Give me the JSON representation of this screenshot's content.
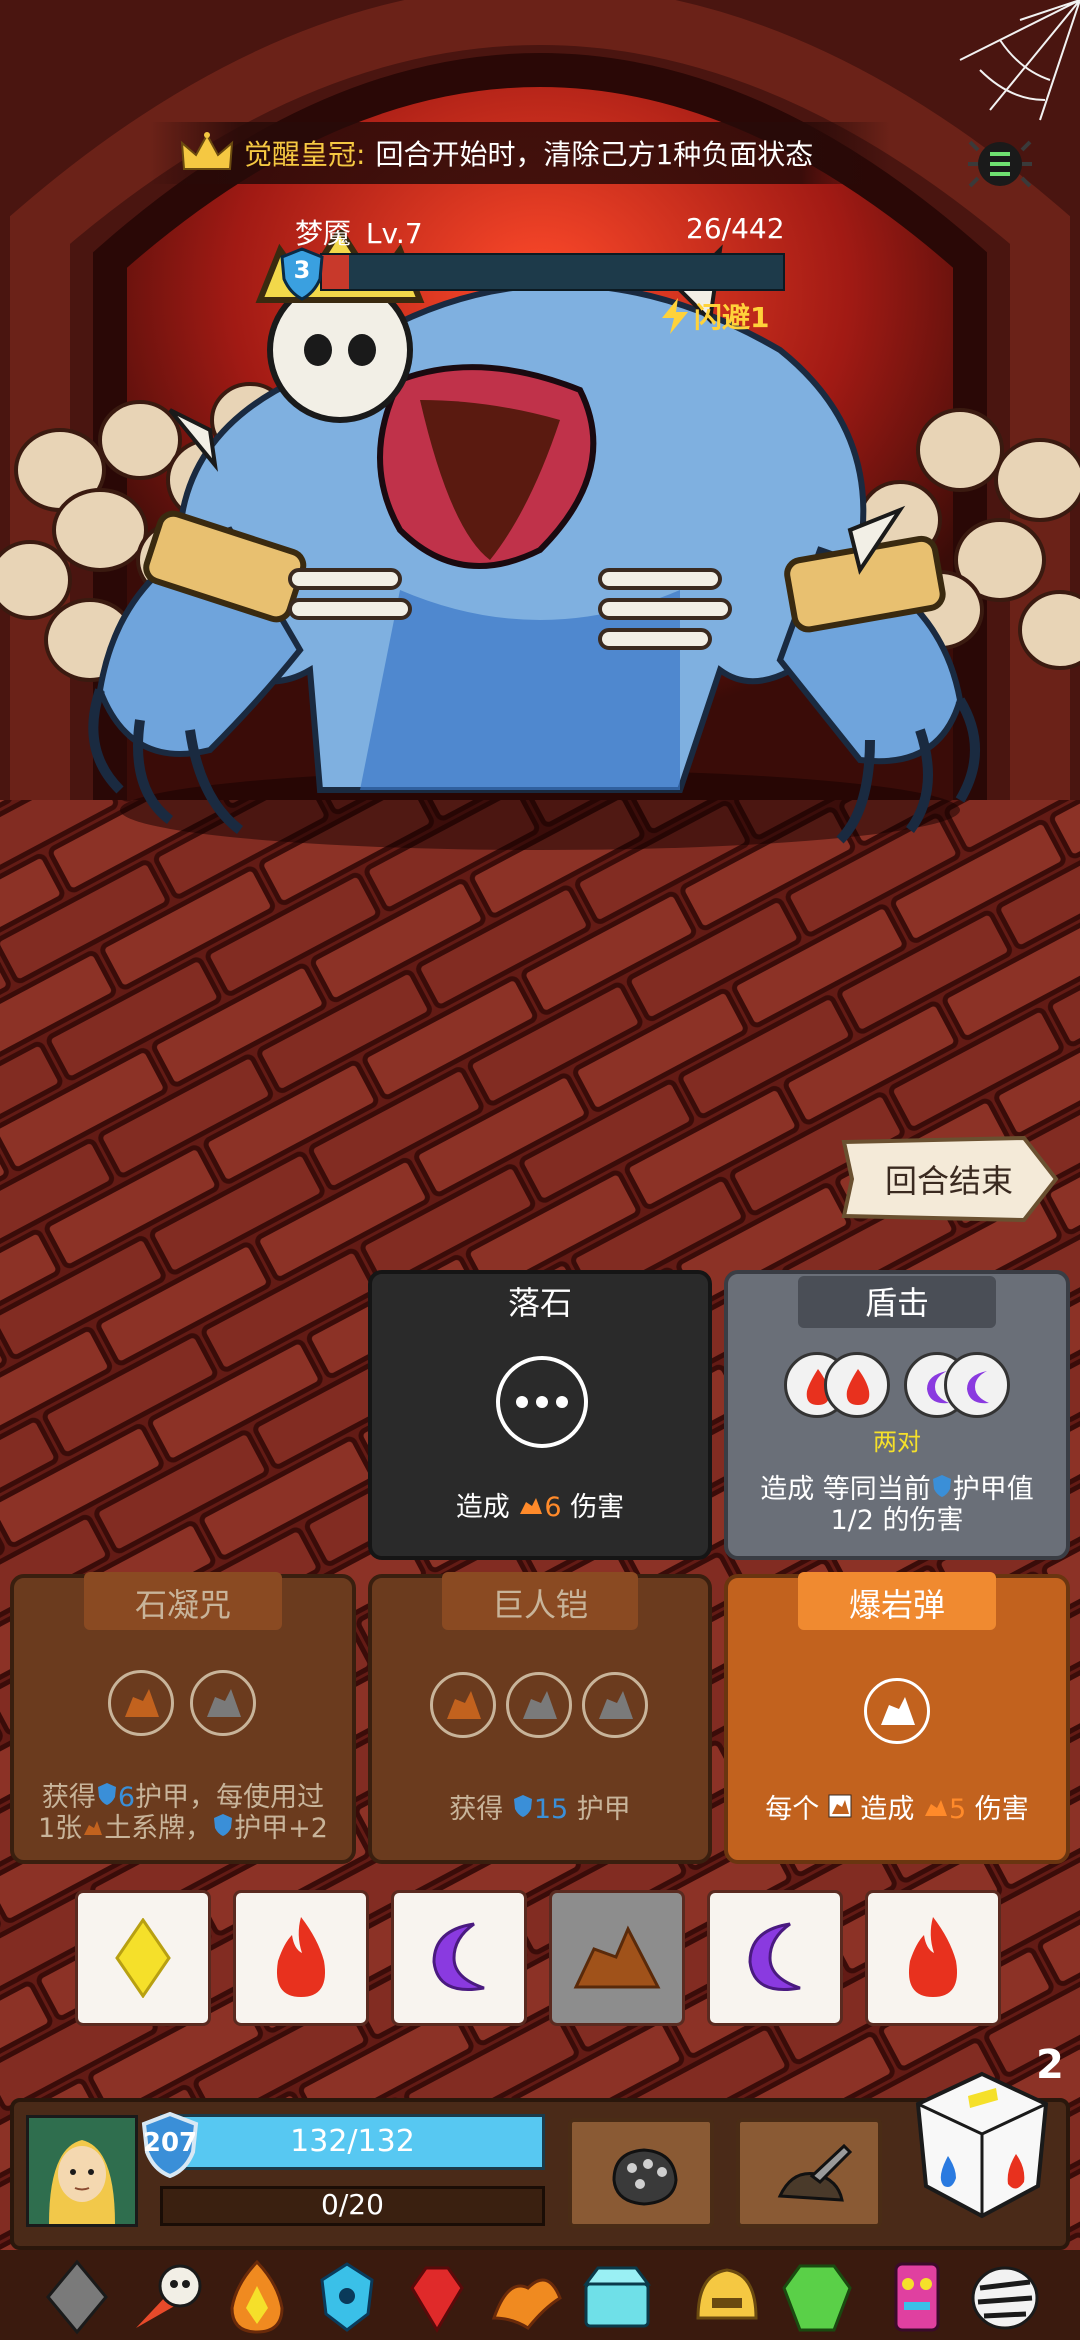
{
  "buff": {
    "name": "觉醒皇冠:",
    "description": "回合开始时，清除己方1种负面状态",
    "icon": "crown-icon"
  },
  "enemy": {
    "name": "梦魇",
    "level": "Lv.7",
    "hp_text": "26/442",
    "hp_fraction": 0.0588,
    "shield": "3",
    "status": "闪避1"
  },
  "end_turn_label": "回合结束",
  "cards": [
    {
      "title": "落石",
      "desc_parts": [
        "造成",
        "6",
        "伤害"
      ],
      "sockets": [
        "any"
      ]
    },
    {
      "title": "盾击",
      "socket_caption": "两对",
      "desc_line1": "造成 等同当前",
      "desc_line1b": "护甲值",
      "desc_line2": "1/2 的伤害",
      "sockets": [
        "fire",
        "fire",
        "moon",
        "moon"
      ]
    },
    {
      "title": "石凝咒",
      "desc_line1a": "获得",
      "desc_line1b": "6",
      "desc_line1c": "护甲，每使用过",
      "desc_line2a": "1张",
      "desc_line2b": "土系牌，",
      "desc_line2c": "护甲+2",
      "sockets": [
        "earth",
        "stone"
      ]
    },
    {
      "title": "巨人铠",
      "desc_a": "获得",
      "desc_b": "15",
      "desc_c": "护甲",
      "sockets": [
        "earth",
        "stone",
        "stone"
      ]
    },
    {
      "title": "爆岩弹",
      "desc_a": "每个",
      "desc_b": "造成",
      "desc_c": "5",
      "desc_d": "伤害",
      "sockets": [
        "earth"
      ]
    }
  ],
  "dice": [
    {
      "face": "diamond",
      "used": false
    },
    {
      "face": "fire",
      "used": false
    },
    {
      "face": "moon",
      "used": false
    },
    {
      "face": "earth",
      "used": true
    },
    {
      "face": "moon",
      "used": false
    },
    {
      "face": "fire",
      "used": false
    }
  ],
  "player": {
    "armor": "207",
    "hp_text": "132/132",
    "hp_fraction": 1.0,
    "energy_text": "0/20",
    "energy_fraction": 0
  },
  "reroll_count": "2",
  "colors": {
    "fire": "#e8311e",
    "moon": "#8a3ae0",
    "earth": "#c2621e",
    "diamond": "#f5e02a",
    "gold": "#f5c842",
    "damage_orange": "#ff8a2a",
    "armor_blue": "#3a8fd8"
  },
  "relic_icons": [
    "gem-gray-icon",
    "flaming-skull-icon",
    "fire-crystal-icon",
    "blue-gem-icon",
    "red-gem-icon",
    "fire-bird-icon",
    "ice-chest-icon",
    "golden-helmet-icon",
    "green-gem-icon",
    "tiki-totem-icon",
    "zebra-skull-icon"
  ]
}
